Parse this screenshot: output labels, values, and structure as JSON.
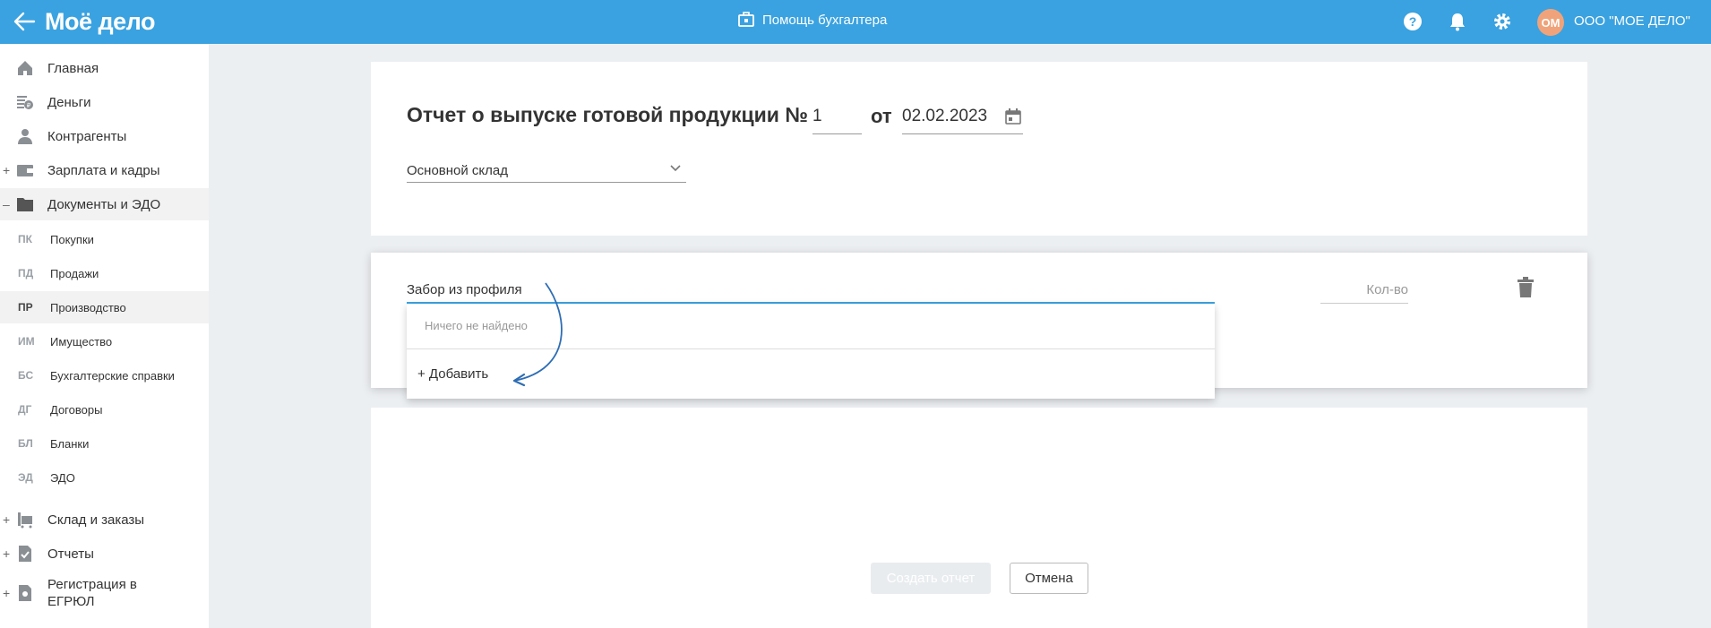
{
  "header": {
    "logo": "Моё дело",
    "help_center": "Помощь бухгалтера",
    "avatar_initials": "ОМ",
    "company_name": "ООО \"МОЕ ДЕЛО\"",
    "accent_color": "#3aa2e0"
  },
  "sidebar": {
    "items": [
      {
        "label": "Главная",
        "icon": "home-icon",
        "expander": ""
      },
      {
        "label": "Деньги",
        "icon": "money-icon",
        "expander": ""
      },
      {
        "label": "Контрагенты",
        "icon": "contractors-icon",
        "expander": ""
      },
      {
        "label": "Зарплата и кадры",
        "icon": "wallet-icon",
        "expander": "+"
      },
      {
        "label": "Документы и ЭДО",
        "icon": "folder-icon",
        "expander": "–"
      }
    ],
    "sub_items": [
      {
        "abbr": "ПК",
        "label": "Покупки"
      },
      {
        "abbr": "ПД",
        "label": "Продажи"
      },
      {
        "abbr": "ПР",
        "label": "Производство"
      },
      {
        "abbr": "ИМ",
        "label": "Имущество"
      },
      {
        "abbr": "БС",
        "label": "Бухгалтерские справки"
      },
      {
        "abbr": "ДГ",
        "label": "Договоры"
      },
      {
        "abbr": "БЛ",
        "label": "Бланки"
      },
      {
        "abbr": "ЭД",
        "label": "ЭДО"
      }
    ],
    "bottom_items": [
      {
        "label": "Склад и заказы",
        "icon": "warehouse-icon",
        "expander": "+"
      },
      {
        "label": "Отчеты",
        "icon": "reports-icon",
        "expander": "+"
      },
      {
        "label": "Регистрация в ЕГРЮЛ",
        "icon": "registration-icon",
        "expander": "+"
      }
    ]
  },
  "form": {
    "title": "Отчет о выпуске готовой продукции №",
    "number": "1",
    "from_label": "от",
    "date": "02.02.2023",
    "warehouse": "Основной склад"
  },
  "product_row": {
    "input_value": "Забор из профиля",
    "qty_placeholder": "Кол-во"
  },
  "dropdown": {
    "empty_text": "Ничего не найдено",
    "add_label": "+ Добавить"
  },
  "actions": {
    "create_label": "Создать отчет",
    "cancel_label": "Отмена"
  }
}
